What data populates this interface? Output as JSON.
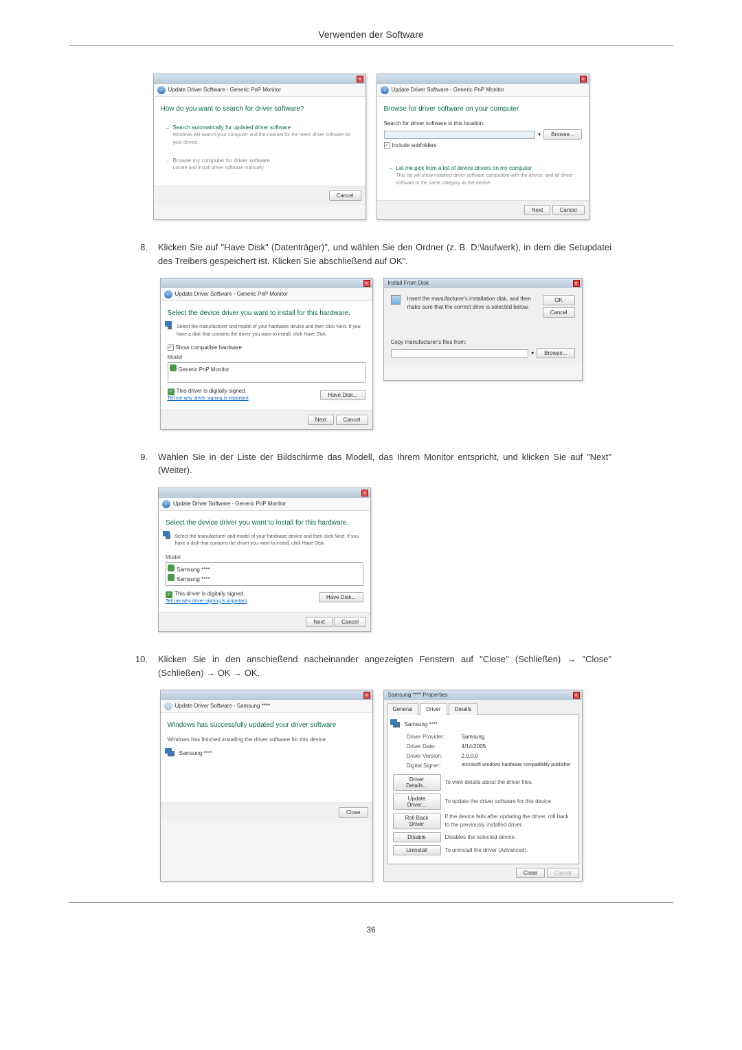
{
  "page_header": "Verwenden der Software",
  "page_number": "36",
  "dialogs": {
    "d1": {
      "title": "Update Driver Software - Generic PnP Monitor",
      "heading": "How do you want to search for driver software?",
      "opt1_title": "Search automatically for updated driver software",
      "opt1_desc": "Windows will search your computer and the Internet for the latest driver software for your device.",
      "opt2_title": "Browse my computer for driver software",
      "opt2_desc": "Locate and install driver software manually.",
      "cancel": "Cancel"
    },
    "d2": {
      "title": "Update Driver Software - Generic PnP Monitor",
      "heading": "Browse for driver software on your computer",
      "search_label": "Search for driver software in this location:",
      "browse": "Browse...",
      "include": "Include subfolders",
      "opt_title": "Let me pick from a list of device drivers on my computer",
      "opt_desc": "This list will show installed driver software compatible with the device, and all driver software in the same category as the device.",
      "next": "Next",
      "cancel": "Cancel"
    },
    "d3": {
      "title": "Update Driver Software - Generic PnP Monitor",
      "heading": "Select the device driver you want to install for this hardware.",
      "instruction": "Select the manufacturer and model of your hardware device and then click Next. If you have a disk that contains the driver you want to install, click Have Disk.",
      "compat": "Show compatible hardware",
      "model_label": "Model",
      "model_item": "Generic PnP Monitor",
      "signed": "This driver is digitally signed.",
      "signed_link": "Tell me why driver signing is important",
      "have_disk": "Have Disk...",
      "next": "Next",
      "cancel": "Cancel"
    },
    "d4": {
      "title": "Install From Disk",
      "text": "Insert the manufacturer's installation disk, and then make sure that the correct drive is selected below.",
      "copy_label": "Copy manufacturer's files from:",
      "ok": "OK",
      "cancel": "Cancel",
      "browse": "Browse..."
    },
    "d5": {
      "title": "Update Driver Software - Generic PnP Monitor",
      "heading": "Select the device driver you want to install for this hardware.",
      "instruction": "Select the manufacturer and model of your hardware device and then click Next. If you have a disk that contains the driver you want to install, click Have Disk.",
      "model_label": "Model",
      "item1": "Samsung ****",
      "item2": "Samsung ****",
      "signed": "This driver is digitally signed.",
      "signed_link": "Tell me why driver signing is important",
      "have_disk": "Have Disk...",
      "next": "Next",
      "cancel": "Cancel"
    },
    "d6": {
      "title": "Update Driver Software - Samsung ****",
      "heading": "Windows has successfully updated your driver software",
      "sub": "Windows has finished installing the driver software for this device:",
      "device": "Samsung ****",
      "close": "Close"
    },
    "d7": {
      "title": "Samsung **** Properties",
      "tabs": [
        "General",
        "Driver",
        "Details"
      ],
      "device": "Samsung ****",
      "provider_l": "Driver Provider:",
      "provider_v": "Samsung",
      "date_l": "Driver Date:",
      "date_v": "4/14/2005",
      "version_l": "Driver Version:",
      "version_v": "2.0.0.0",
      "signer_l": "Digital Signer:",
      "signer_v": "microsoft windows hardware compatibility publisher",
      "btn_details": "Driver Details...",
      "desc_details": "To view details about the driver files.",
      "btn_update": "Update Driver...",
      "desc_update": "To update the driver software for this device.",
      "btn_rollback": "Roll Back Driver",
      "desc_rollback": "If the device fails after updating the driver, roll back to the previously installed driver.",
      "btn_disable": "Disable",
      "desc_disable": "Disables the selected device.",
      "btn_uninstall": "Uninstall",
      "desc_uninstall": "To uninstall the driver (Advanced).",
      "close": "Close",
      "cancel": "Cancel"
    }
  },
  "steps": {
    "s8": {
      "num": "8.",
      "text": "Klicken Sie auf \"Have Disk\" (Datenträger)\", und wählen Sie den Ordner (z. B. D:\\laufwerk), in dem die Setupdatei des Treibers gespeichert ist. Klicken Sie abschließend auf OK\"."
    },
    "s9": {
      "num": "9.",
      "text": "Wählen Sie in der Liste der Bildschirme das Modell, das Ihrem Monitor entspricht, und klicken Sie auf \"Next\" (Weiter)."
    },
    "s10": {
      "num": "10.",
      "text": "Klicken Sie in den anschießend nacheinander angezeigten Fenstern auf \"Close\" (Schließen) → \"Close\" (Schließen) → OK → OK."
    }
  }
}
